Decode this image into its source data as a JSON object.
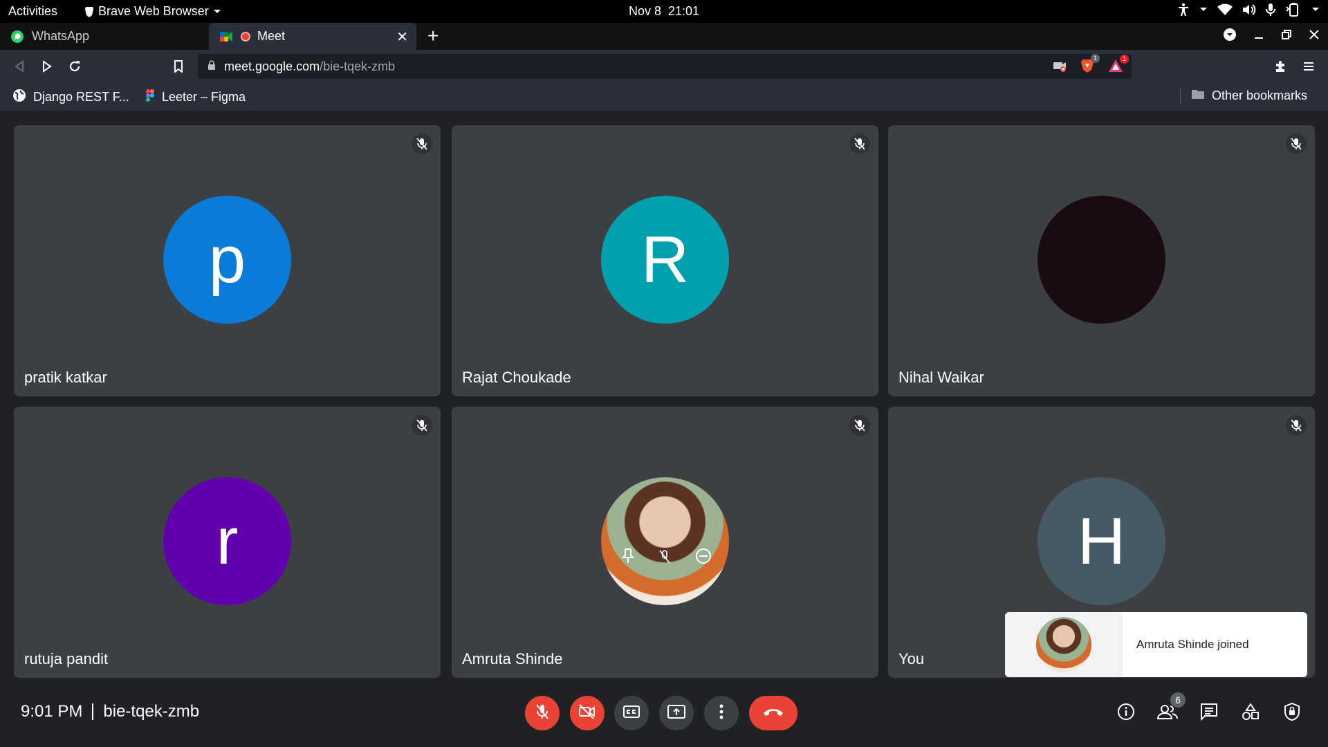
{
  "topbar": {
    "activities": "Activities",
    "app_name": "Brave Web Browser",
    "date": "Nov 8",
    "time": "21:01"
  },
  "tabs": [
    {
      "label": "WhatsApp",
      "icon": "whatsapp-icon",
      "active": false
    },
    {
      "label": "Meet",
      "icon": "meet-icon",
      "active": true
    }
  ],
  "address": {
    "host": "meet.google.com",
    "path": "/bie-tqek-zmb"
  },
  "extensions": {
    "brave_shields_count": "1",
    "brave_rewards_count": "1"
  },
  "bookmarks": {
    "items": [
      {
        "label": "Django REST F...",
        "icon": "globe-icon"
      },
      {
        "label": "Leeter – Figma",
        "icon": "figma-icon"
      }
    ],
    "other": "Other bookmarks"
  },
  "participants": [
    {
      "name": "pratik katkar",
      "initial": "p",
      "color": "#0b7bd8"
    },
    {
      "name": "Rajat Choukade",
      "initial": "R",
      "color": "#00a0ae"
    },
    {
      "name": "Nihal Waikar",
      "initial": "",
      "color": "#1a0a12"
    },
    {
      "name": "rutuja pandit",
      "initial": "r",
      "color": "#6200b0"
    },
    {
      "name": "Amruta Shinde",
      "initial": "",
      "color": "#b98262"
    },
    {
      "name": "You",
      "initial": "H",
      "color": "#455a64"
    }
  ],
  "toast": {
    "message": "Amruta Shinde joined"
  },
  "meeting": {
    "time": "9:01 PM",
    "code": "bie-tqek-zmb",
    "people_count": "6"
  },
  "colors": {
    "danger": "#ea4335",
    "tile_bg": "#3c4043",
    "page_bg": "#202124"
  }
}
